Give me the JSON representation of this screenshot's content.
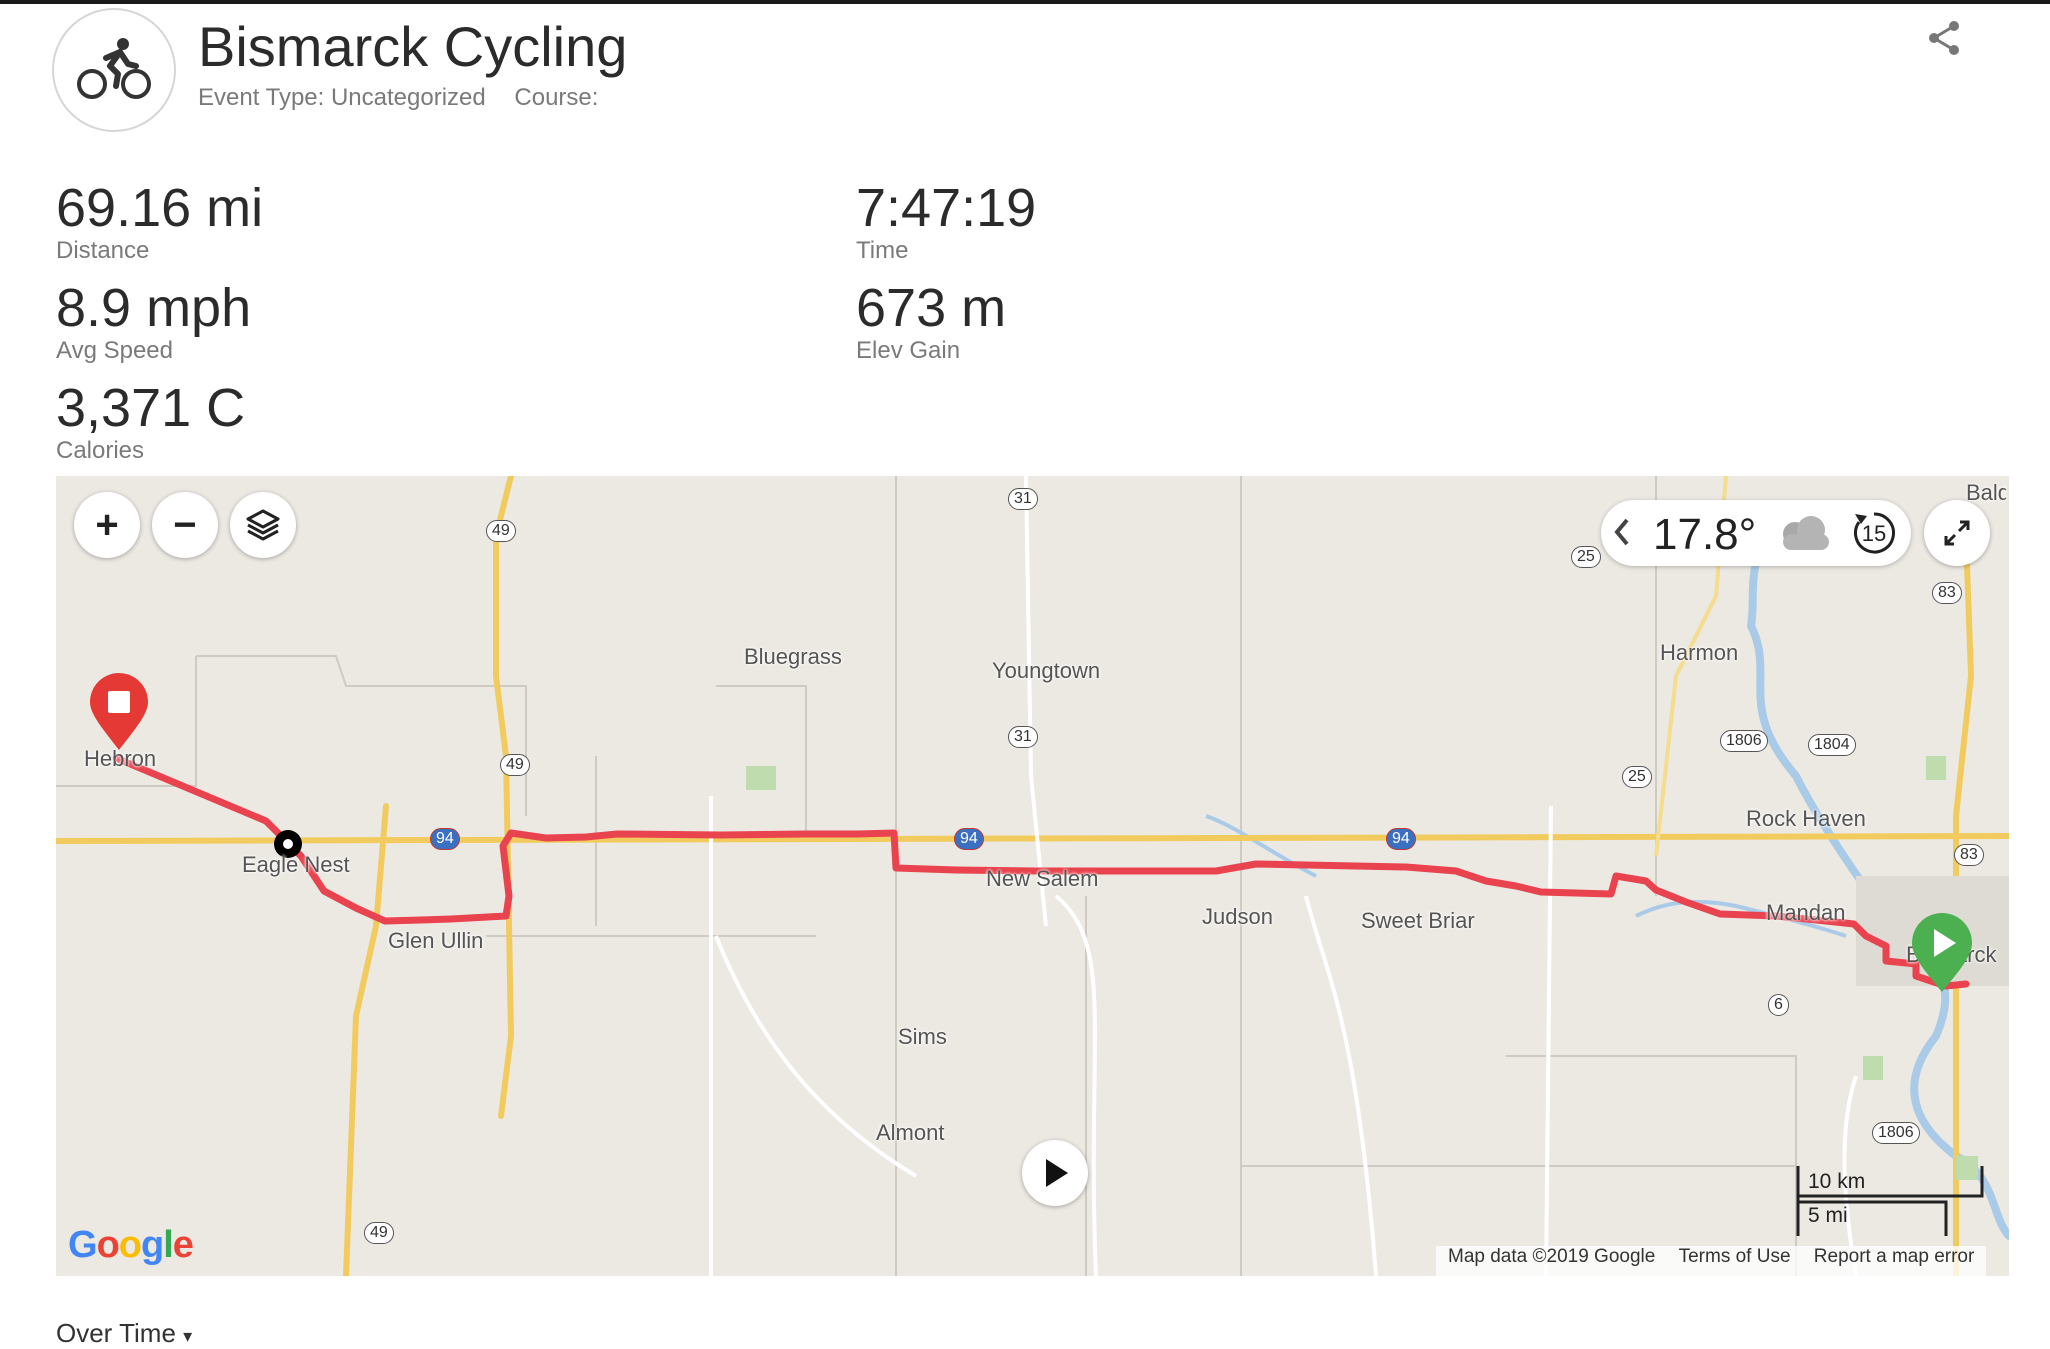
{
  "header": {
    "title": "Bismarck Cycling",
    "event_type": "Event Type: Uncategorized",
    "course": "Course:"
  },
  "stats": [
    {
      "value": "69.16 mi",
      "label": "Distance"
    },
    {
      "value": "7:47:19",
      "label": "Time"
    },
    {
      "value": "8.9 mph",
      "label": "Avg Speed"
    },
    {
      "value": "673 m",
      "label": "Elev Gain"
    },
    {
      "value": "3,371 C",
      "label": "Calories"
    }
  ],
  "map": {
    "places": [
      "Bluegrass",
      "Youngtown",
      "Harmon",
      "Hebron",
      "Eagle Nest",
      "Glen Ullin",
      "New Salem",
      "Judson",
      "Sweet Briar",
      "Rock Haven",
      "Mandan",
      "Sims",
      "Almont",
      "Bismarck",
      "Bald"
    ],
    "shields": [
      "31",
      "49",
      "25",
      "83",
      "1806",
      "1804",
      "94",
      "6"
    ],
    "weather": {
      "temperature": "17.8°",
      "timer": "15"
    },
    "scale": {
      "metric": "10 km",
      "imperial": "5 mi"
    },
    "attribution": {
      "data": "Map data ©2019 Google",
      "terms": "Terms of Use",
      "report": "Report a map error"
    },
    "logo": "Google",
    "colors": {
      "route": "#e8434e",
      "start": "#4caf50",
      "end": "#e53935",
      "highway": "#f2cb5f",
      "water": "#a9cbe8"
    }
  },
  "section": {
    "over_time": "Over Time"
  }
}
